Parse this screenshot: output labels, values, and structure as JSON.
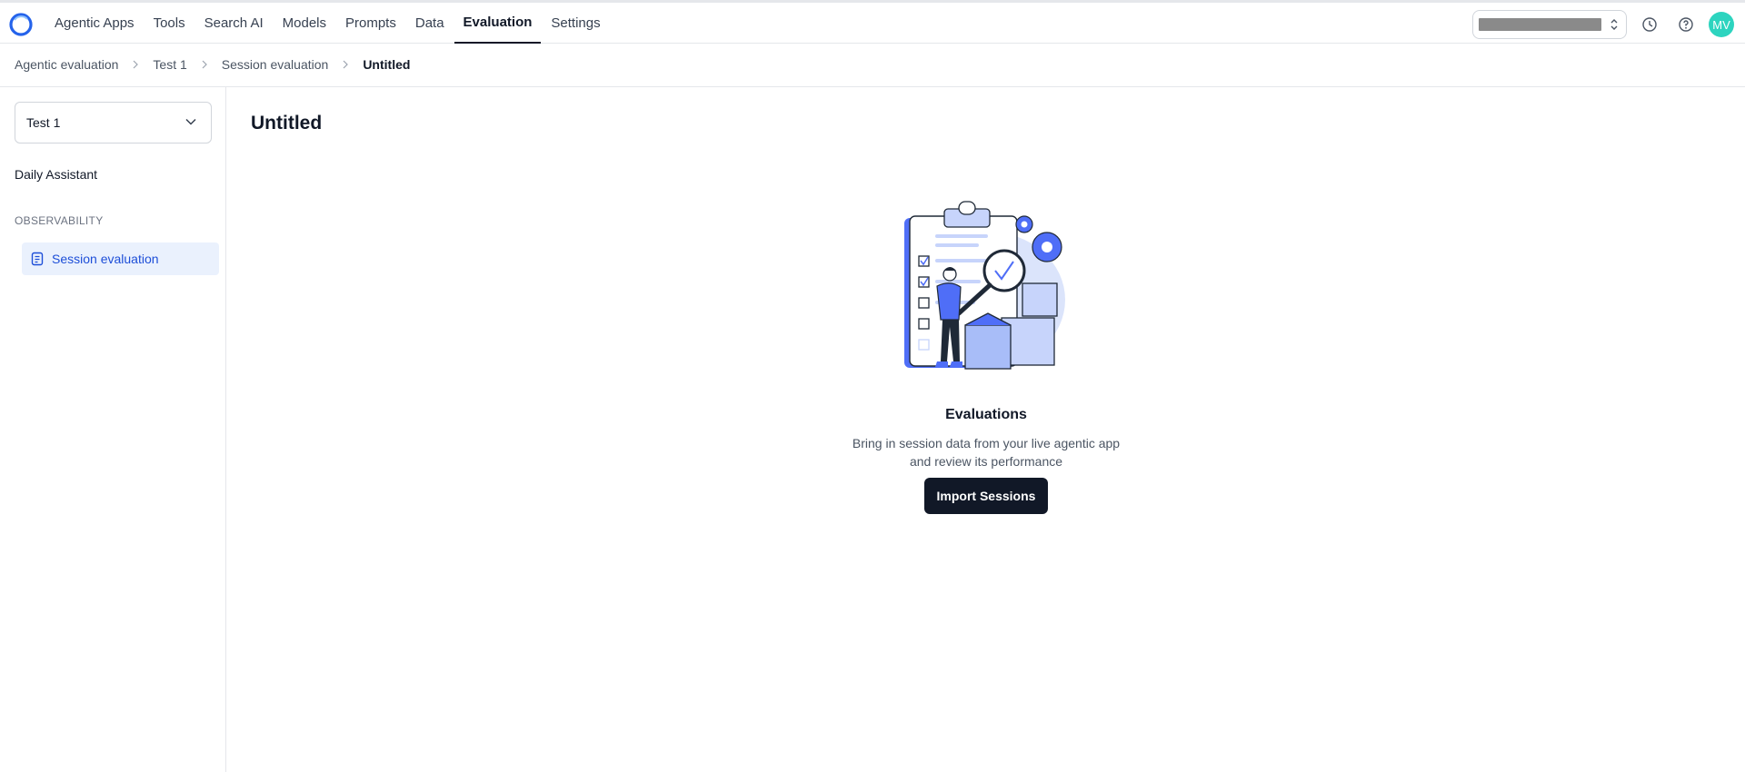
{
  "nav": {
    "items": [
      {
        "label": "Agentic Apps"
      },
      {
        "label": "Tools"
      },
      {
        "label": "Search AI"
      },
      {
        "label": "Models"
      },
      {
        "label": "Prompts"
      },
      {
        "label": "Data"
      },
      {
        "label": "Evaluation",
        "active": true
      },
      {
        "label": "Settings"
      }
    ]
  },
  "header": {
    "avatar_initials": "MV",
    "icons": [
      "history-icon",
      "help-icon"
    ]
  },
  "breadcrumb": [
    "Agentic evaluation",
    "Test 1",
    "Session evaluation",
    "Untitled"
  ],
  "sidebar": {
    "project_select": "Test 1",
    "app_name": "Daily Assistant",
    "section_label": "OBSERVABILITY",
    "items": [
      {
        "label": "Session evaluation",
        "icon": "document-icon",
        "active": true
      }
    ]
  },
  "main": {
    "title": "Untitled",
    "empty_state": {
      "title": "Evaluations",
      "description_line1": "Bring in session data from your live agentic app",
      "description_line2": "and review its performance",
      "button_label": "Import Sessions"
    }
  },
  "colors": {
    "accent_blue": "#4f6ef7",
    "active_item_bg": "#eaf1fd",
    "primary_button": "#111827",
    "avatar_bg": "#2dd4bf"
  }
}
